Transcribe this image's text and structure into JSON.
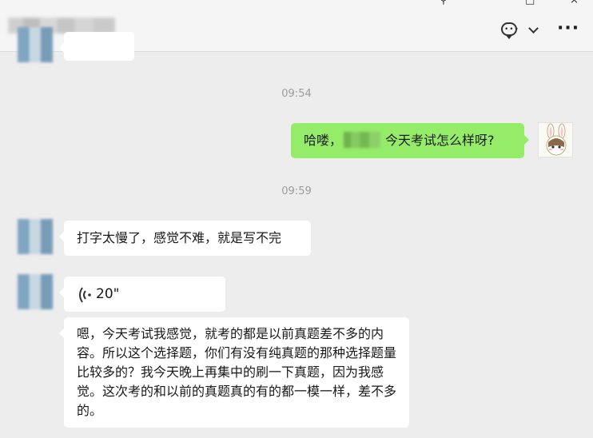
{
  "window": {
    "pin_glyph": "⚲",
    "maximize_glyph": "□",
    "close_glyph": "×"
  },
  "header": {
    "icons": [
      "chat-bubble-icon",
      "chevron-down-icon",
      "more-icon"
    ],
    "more_glyph": "···"
  },
  "messages": {
    "timestamp_1": "09:54",
    "sent_1_before": "哈喽，",
    "sent_1_after": "今天考试怎么样呀?",
    "timestamp_2": "09:59",
    "received_1": "打字太慢了，感觉不难，就是写不完",
    "voice_duration": "20\"",
    "received_2": "嗯，今天考试我感觉，就考的都是以前真题差不多的内容。所以这个选择题，你们有没有纯真题的那种选择题量比较多的？我今天晚上再集中的刷一下真题，因为我感觉。这次考的和以前的真题真的有的都一模一样，差不多的。"
  },
  "colors": {
    "background": "#ededed",
    "sent_bubble": "#95ec69",
    "received_bubble": "#ffffff",
    "timestamp": "#9b9b9b"
  }
}
